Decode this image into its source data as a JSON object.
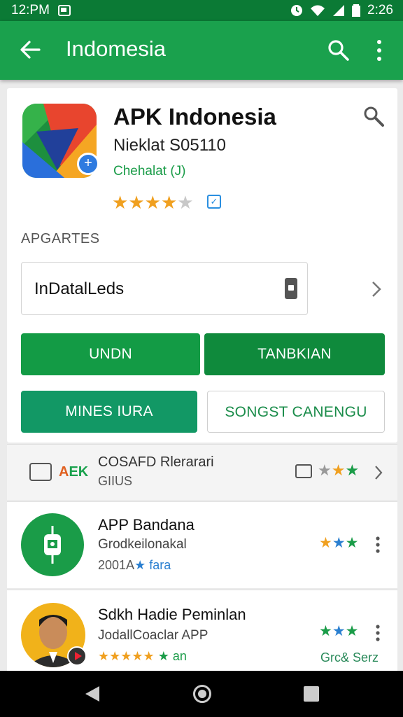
{
  "status_bar": {
    "left_text": "12:PM",
    "time": "2:26"
  },
  "app_bar": {
    "title": "Indomesia",
    "icons": [
      "back-arrow-icon",
      "search-icon",
      "more-vert-icon"
    ]
  },
  "app": {
    "title": "APK Indonesia",
    "subtitle": "Nieklat  S05110",
    "developer": "Chehalat (J)",
    "rating": 4,
    "rating_max": 5
  },
  "section_label": "APGARTES",
  "install_box": {
    "text": "InDatalLeds"
  },
  "buttons": {
    "undn": "UNDN",
    "tanbkian": "TANBKIAN",
    "mines_iura": "MINES IURA",
    "songst_canengu": "SONGST CANENGU"
  },
  "apk_row": {
    "tag_a": "A",
    "tag_k": "K",
    "tag_e": "E",
    "line1": "COSAFD Rlerarari",
    "line2": "GIIUS",
    "stars": "★★★"
  },
  "list": [
    {
      "title": "APP Bandana",
      "subtitle": "Grodkeilonakal",
      "meta_a": "2001A",
      "meta_b": "★ fara",
      "stars": "★★★"
    },
    {
      "title": "Sdkh Hadie Peminlan",
      "subtitle": "JodallCoaclar APP",
      "meta_a": "★★★★★",
      "meta_b": "★ an",
      "stars": "★★★",
      "extra": "Grc& Serz"
    }
  ],
  "colors": {
    "appbar": "#1aa14d",
    "statusbar": "#0b7a35",
    "accent": "#139b45",
    "star": "#f0a020"
  }
}
